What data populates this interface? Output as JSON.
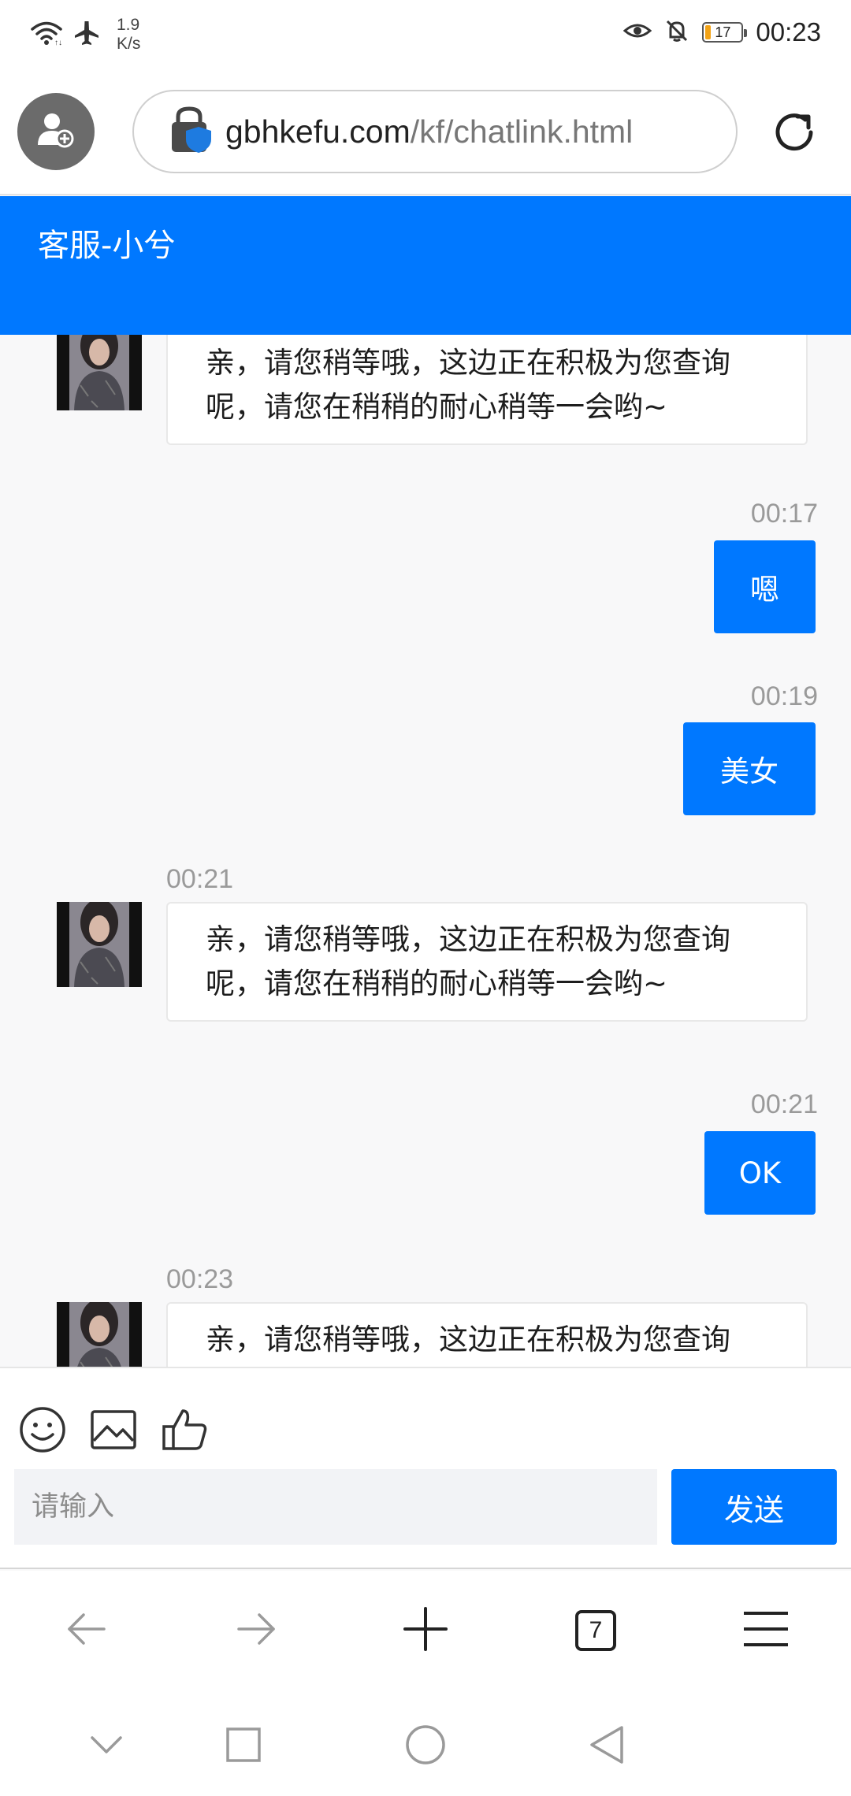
{
  "status_bar": {
    "network_speed": "1.9",
    "network_speed_unit": "K/s",
    "battery_level": "17",
    "battery_fraction": 0.17,
    "time": "00:23",
    "icons": [
      "wifi-icon",
      "airplane-mode-icon",
      "eye-comfort-icon",
      "mute-icon",
      "battery-icon"
    ]
  },
  "address_bar": {
    "url_domain": "gbhkefu.com",
    "url_path": "/kf/chatlink.html",
    "icons": [
      "profile-add-icon",
      "secure-lock-icon",
      "refresh-icon"
    ]
  },
  "chat_header": {
    "title": "客服-小兮"
  },
  "messages": [
    {
      "from": "agent",
      "time": "",
      "text": "亲，请您稍等哦，这边正在积极为您查询呢，请您在稍稍的耐心稍等一会哟~"
    },
    {
      "from": "user",
      "time": "00:17",
      "text": "嗯"
    },
    {
      "from": "user",
      "time": "00:19",
      "text": "美女"
    },
    {
      "from": "agent",
      "time": "00:21",
      "text": "亲，请您稍等哦，这边正在积极为您查询呢，请您在稍稍的耐心稍等一会哟~"
    },
    {
      "from": "user",
      "time": "00:21",
      "text": "OK"
    },
    {
      "from": "agent",
      "time": "00:23",
      "text": "亲，请您稍等哦，这边正在积极为您查询"
    }
  ],
  "composer": {
    "tools": [
      "emoji-icon",
      "image-icon",
      "thumbs-up-icon"
    ],
    "input_placeholder": "请输入",
    "input_value": "",
    "send_label": "发送"
  },
  "browser_toolbar": {
    "tab_count": "7",
    "icons": [
      "back-arrow-icon",
      "forward-arrow-icon",
      "new-tab-plus-icon",
      "tabs-icon",
      "menu-icon"
    ]
  },
  "system_nav": {
    "icons": [
      "collapse-chevron-icon",
      "recents-square-icon",
      "home-circle-icon",
      "back-triangle-icon"
    ]
  }
}
